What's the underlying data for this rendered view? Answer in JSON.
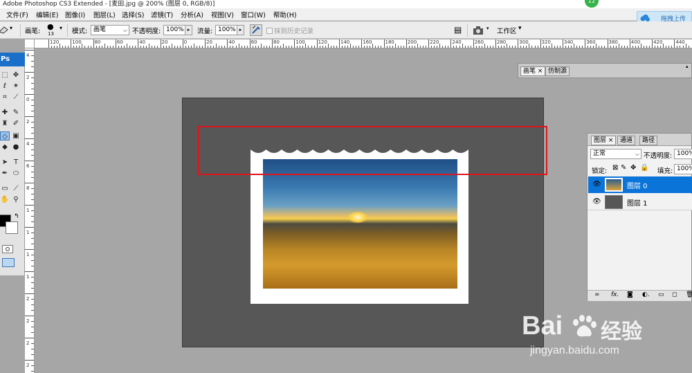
{
  "app": {
    "title": "Adobe Photoshop CS3 Extended - [麦田.jpg @ 200% (图层 0, RGB/8)]"
  },
  "badge": {
    "text": "12"
  },
  "menu": [
    "文件(F)",
    "编辑(E)",
    "图像(I)",
    "图层(L)",
    "选择(S)",
    "滤镜(T)",
    "分析(A)",
    "视图(V)",
    "窗口(W)",
    "帮助(H)"
  ],
  "upload": {
    "label": "拖拽上传"
  },
  "options": {
    "brush_label": "画笔:",
    "brush_size": "13",
    "mode_label": "模式:",
    "mode_value": "画笔",
    "opacity_label": "不透明度:",
    "opacity_value": "100%",
    "flow_label": "流量:",
    "flow_value": "100%",
    "history_label": "抹到历史记录",
    "workspace_label": "工作区"
  },
  "ruler": {
    "top": [
      "120",
      "100",
      "80",
      "60",
      "40",
      "20",
      "0",
      "20",
      "40",
      "60",
      "80",
      "100",
      "120",
      "140",
      "160",
      "180",
      "200",
      "220",
      "240",
      "260",
      "280",
      "300",
      "320",
      "340",
      "360",
      "380",
      "400",
      "420",
      "440"
    ],
    "left": [
      "4",
      "2",
      "0",
      "2",
      "4",
      "6",
      "8",
      "1",
      "1",
      "1",
      "1",
      "2",
      "2",
      "2",
      "2"
    ]
  },
  "toolbox": {
    "logo": "Ps"
  },
  "panels": {
    "top_tabs": [
      "画笔",
      "仿制源"
    ],
    "layers_tabs": [
      "图层",
      "通道",
      "路径"
    ],
    "blend_mode": "正常",
    "opacity_label": "不透明度:",
    "opacity_value": "100%",
    "lock_label": "锁定:",
    "fill_label": "填充:",
    "fill_value": "100%",
    "layers": [
      {
        "name": "图层 0",
        "selected": true
      },
      {
        "name": "图层 1",
        "selected": false
      }
    ]
  },
  "watermark": {
    "brand": "Bai",
    "brand2": "经验",
    "url": "jingyan.baidu.com"
  },
  "colors": {
    "accent": "#0a74d9",
    "highlight": "#e0141b",
    "canvas": "#575757"
  }
}
